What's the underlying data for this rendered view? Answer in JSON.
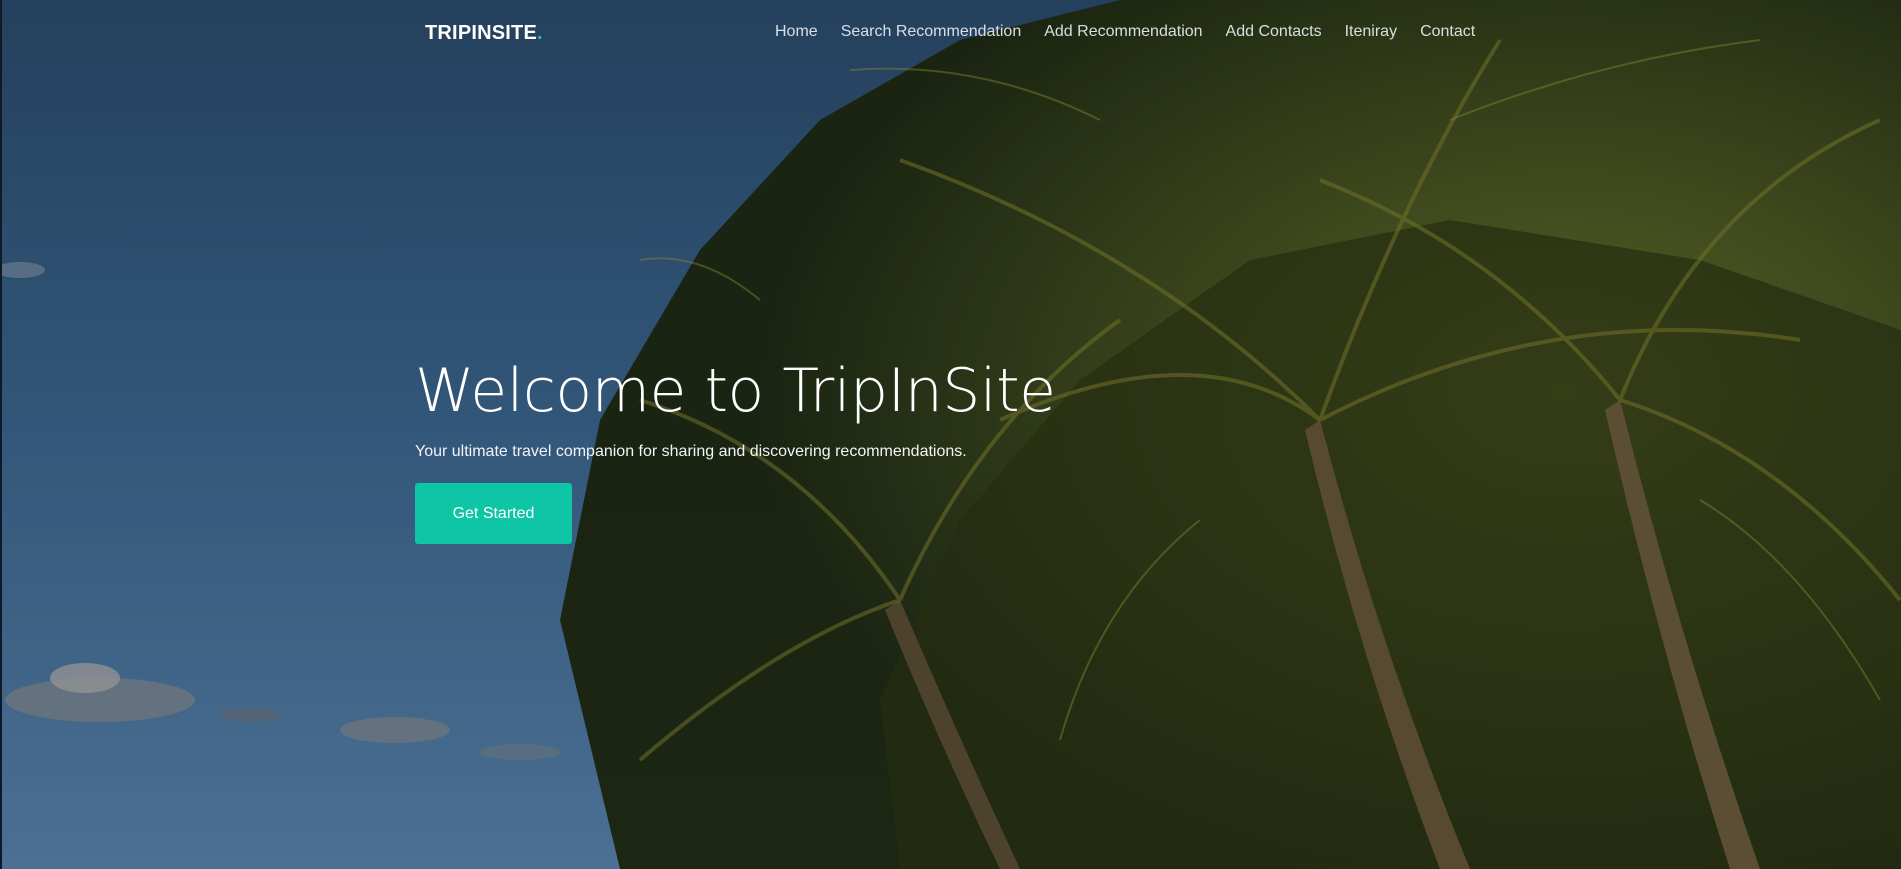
{
  "brand": {
    "name": "TRIPINSITE",
    "dot": ".",
    "accent_color": "#19c3a6"
  },
  "nav": {
    "items": [
      {
        "label": "Home"
      },
      {
        "label": "Search Recommendation"
      },
      {
        "label": "Add Recommendation"
      },
      {
        "label": "Add Contacts"
      },
      {
        "label": "Iteniray"
      },
      {
        "label": "Contact"
      }
    ]
  },
  "hero": {
    "title": "Welcome to TripInSite",
    "subtitle": "Your ultimate travel companion for sharing and discovering recommendations.",
    "cta_label": "Get Started",
    "cta_color": "#0ec5a6",
    "background": "palm-trees-beach-photo"
  }
}
